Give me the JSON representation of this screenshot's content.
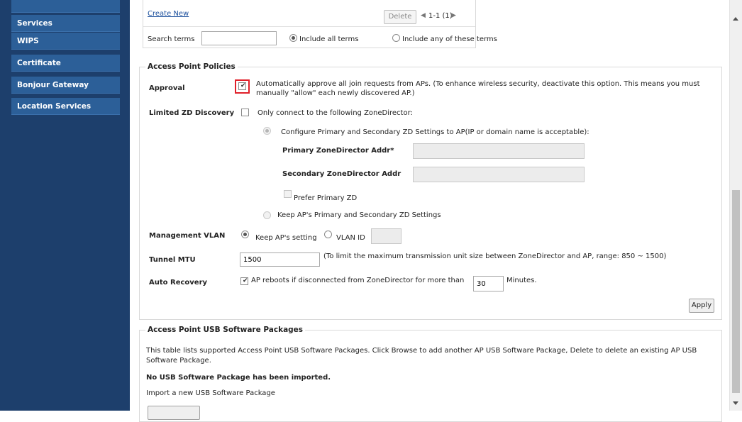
{
  "sidebar": {
    "items": [
      {
        "label": "Services"
      },
      {
        "label": "WIPS"
      },
      {
        "label": "Certificate"
      },
      {
        "label": "Bonjour Gateway"
      },
      {
        "label": "Location Services"
      }
    ]
  },
  "top_table": {
    "create_new": "Create New",
    "delete_label": "Delete",
    "pagination": "1-1 (1)",
    "search_label": "Search terms",
    "search_value": "",
    "include_all": "Include all terms",
    "include_any": "Include any of these terms"
  },
  "ap_policies": {
    "legend": "Access Point Policies",
    "approval": {
      "label": "Approval",
      "checked": true,
      "text_line1": "Automatically approve all join requests from APs. (To enhance wireless security, deactivate this option. This means you must",
      "text_line2": "manually \"allow\" each newly discovered AP.)"
    },
    "limited_zd": {
      "label": "Limited ZD Discovery",
      "text": "Only connect to the following ZoneDirector:",
      "configure_option": "Configure Primary and Secondary ZD Settings to AP(IP or domain name is acceptable):",
      "primary_label": "Primary ZoneDirector Addr*",
      "primary_value": "",
      "secondary_label": "Secondary ZoneDirector Addr",
      "secondary_value": "",
      "prefer_primary": "Prefer Primary ZD",
      "keep_option": "Keep AP's Primary and Secondary ZD Settings"
    },
    "mgmt_vlan": {
      "label": "Management VLAN",
      "keep_setting": "Keep AP's setting",
      "vlan_id": "VLAN ID",
      "vlan_value": ""
    },
    "tunnel_mtu": {
      "label": "Tunnel MTU",
      "value": "1500",
      "hint": "(To limit the maximum transmission unit size between ZoneDirector and AP, range: 850 ~ 1500)"
    },
    "auto_recovery": {
      "label": "Auto Recovery",
      "checked": true,
      "text_before": "AP reboots if disconnected from ZoneDirector for more than",
      "value": "30",
      "text_after": "Minutes."
    },
    "apply_label": "Apply"
  },
  "usb_packages": {
    "legend": "Access Point USB Software Packages",
    "desc_line1": "This table lists supported Access Point USB Software Packages. Click Browse to add another AP USB Software Package, Delete to delete an existing AP USB",
    "desc_line2": "Software Package.",
    "status": "No USB Software Package has been imported.",
    "import_label": "Import a new USB Software Package"
  },
  "colors": {
    "sidebar_bg": "#1d3f6c",
    "sidebar_item": "#2c5f98",
    "highlight": "#e0202a",
    "link": "#1a4e9c"
  }
}
